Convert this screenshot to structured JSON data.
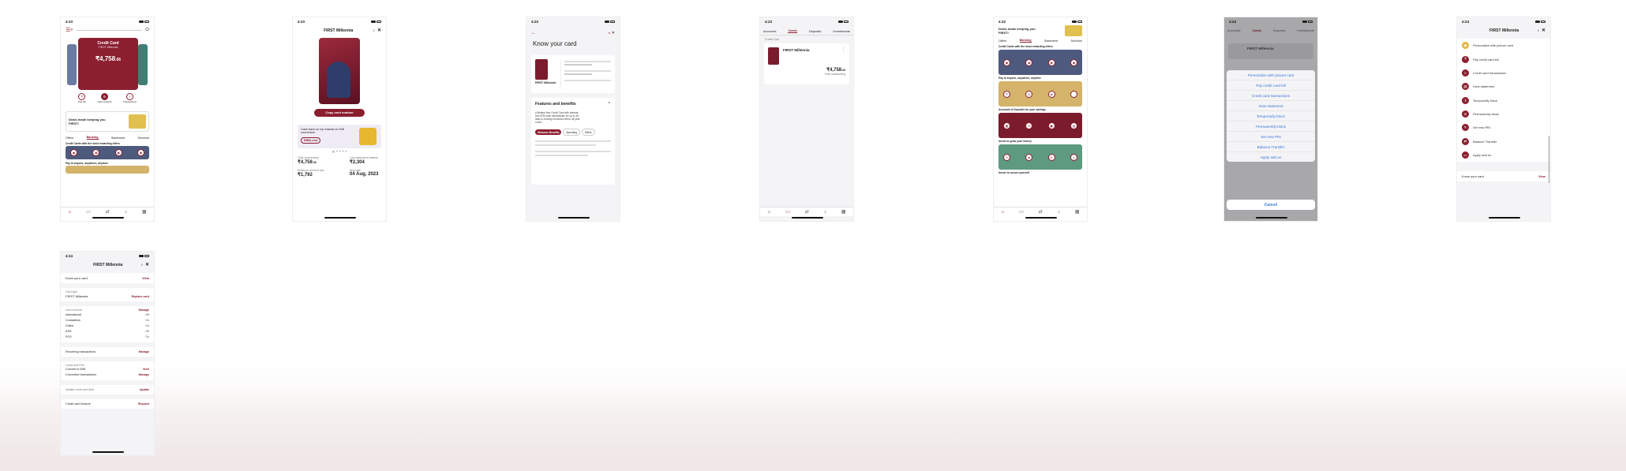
{
  "screens": {
    "home": {
      "time": "4:23",
      "card_title": "Credit Card",
      "card_sub": "FIRST Millennia",
      "card_amount": "₹4,758",
      "card_amount_dec": ".06",
      "actions": [
        "Pay bill",
        "Card controls",
        "Transactions"
      ],
      "promo": "Deals made keeping you FIRST!",
      "tabs": [
        "Offers",
        "Banking",
        "Statement",
        "Services"
      ],
      "section": "Credit Cards with the most rewarding offers",
      "pay_label": "Pay to anyone, anywhere, anytime"
    },
    "card_detail": {
      "time": "4:23",
      "title": "FIRST Millennia",
      "copy_button": "Copy card number",
      "promo": "Cash back on top brands on EMI conversion",
      "promo_cta": "EMIfy now",
      "total_label": "Total outstanding",
      "total_value": "₹4,758",
      "total_dec": ".06",
      "last_label": "Last statement balance",
      "last_value": "₹2,304",
      "min_label": "Minimum amount due",
      "min_value": "₹1,792",
      "due_label": "Due date",
      "due_value": "04 Aug, 2023"
    },
    "know_card": {
      "time": "4:23",
      "title": "Know your card",
      "card_name": "FIRST Millennia",
      "features_title": "Features and benefits",
      "features_text": "A lifetime free Credit Card with interest-free ATM cash withdrawals for up to 48 days & exciting merchant offers, all year round",
      "pill_active": "Welcome Benefits",
      "pills": [
        "Spending",
        "Offers"
      ]
    },
    "cards_list": {
      "time": "4:23",
      "tabs": [
        "Accounts",
        "Cards",
        "Deposits",
        "Investments"
      ],
      "section": "Credit Card",
      "card_name": "FIRST Millennia",
      "amount": "₹4,758",
      "amount_dec": ".06",
      "amount_label": "Total outstanding"
    },
    "banking": {
      "time": "4:23",
      "promo": "Deals made keeping you FIRST!",
      "tabs": [
        "Offers",
        "Banking",
        "Statement",
        "Services"
      ],
      "sec1": "Credit Cards with the most rewarding offers",
      "sec2": "Pay to anyone, anywhere, anytime",
      "sec3": "Accounts & Deposits for your savings",
      "sec4": "Invest to grow your money",
      "sec5": "Insure to secure yourself"
    },
    "action_sheet": {
      "time": "4:24",
      "tabs": [
        "Accounts",
        "Cards",
        "Deposits",
        "Investments"
      ],
      "card_name": "FIRST Millennia",
      "options": [
        "Personalize with picture card",
        "Pay credit card bill",
        "Credit card transactions",
        "View statement",
        "Temporarily block",
        "Permanently block",
        "Set new PIN",
        "Balance Transfer",
        "Apply add on"
      ],
      "cancel": "Cancel"
    },
    "menu": {
      "time": "4:24",
      "title": "FIRST Millennia",
      "items": [
        "Personalize with picture card",
        "Pay credit card bill",
        "Credit card transactions",
        "View statement",
        "Temporarily block",
        "Permanently block",
        "Set new PIN",
        "Balance Transfer",
        "Apply add on"
      ],
      "footer_label": "Know your card",
      "footer_link": "View"
    },
    "settings": {
      "time": "4:24",
      "title": "FIRST Millennia",
      "know_label": "Know your card",
      "know_link": "View",
      "card_type_label": "Card type",
      "card_type": "FIRST Millennia",
      "replace": "Replace card",
      "controls_label": "Card controls",
      "manage": "Manage",
      "controls": [
        {
          "k": "International",
          "v": "Off"
        },
        {
          "k": "Contactless",
          "v": "On"
        },
        {
          "k": "Online",
          "v": "On"
        },
        {
          "k": "ATM",
          "v": "Off"
        },
        {
          "k": "POS",
          "v": "On"
        }
      ],
      "recurring": "Recurring transactions",
      "loans_label": "Loans and EMI",
      "convert": "Convert to EMI",
      "converted": "Converted transactions",
      "update_label": "Update credit card limit",
      "update": "Update",
      "closure": "Credit card closure",
      "request": "Request"
    }
  }
}
